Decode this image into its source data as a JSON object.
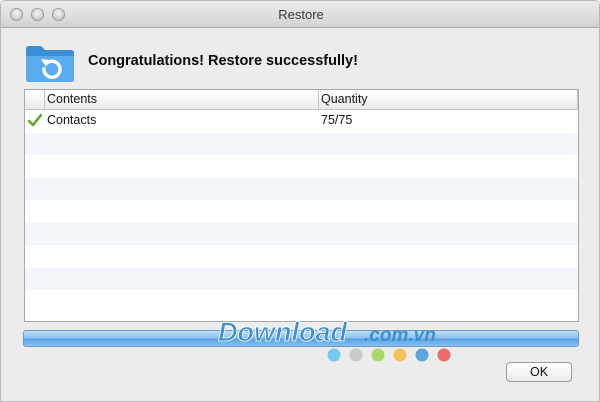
{
  "window": {
    "title": "Restore"
  },
  "header": {
    "message": "Congratulations! Restore successfully!",
    "icon": "restore-folder-icon"
  },
  "table": {
    "columns": [
      "Contents",
      "Quantity"
    ],
    "rows": [
      {
        "status_icon": "check-icon",
        "contents": "Contents",
        "quantity": ""
      }
    ],
    "items": [
      {
        "status_icon": "check-icon",
        "contents": "Contacts",
        "quantity": "75/75"
      }
    ]
  },
  "progress": {
    "value": 1.0
  },
  "watermark": {
    "text": "Download",
    "suffix": ".com.vn",
    "dot_colors": [
      "#74c9ef",
      "#c9c9c9",
      "#a8d86a",
      "#f5c25a",
      "#5aa6dc",
      "#ec6b6b"
    ]
  },
  "buttons": {
    "ok_label": "OK"
  },
  "colors": {
    "accent": "#5ea3e3",
    "check": "#5fa82a"
  }
}
